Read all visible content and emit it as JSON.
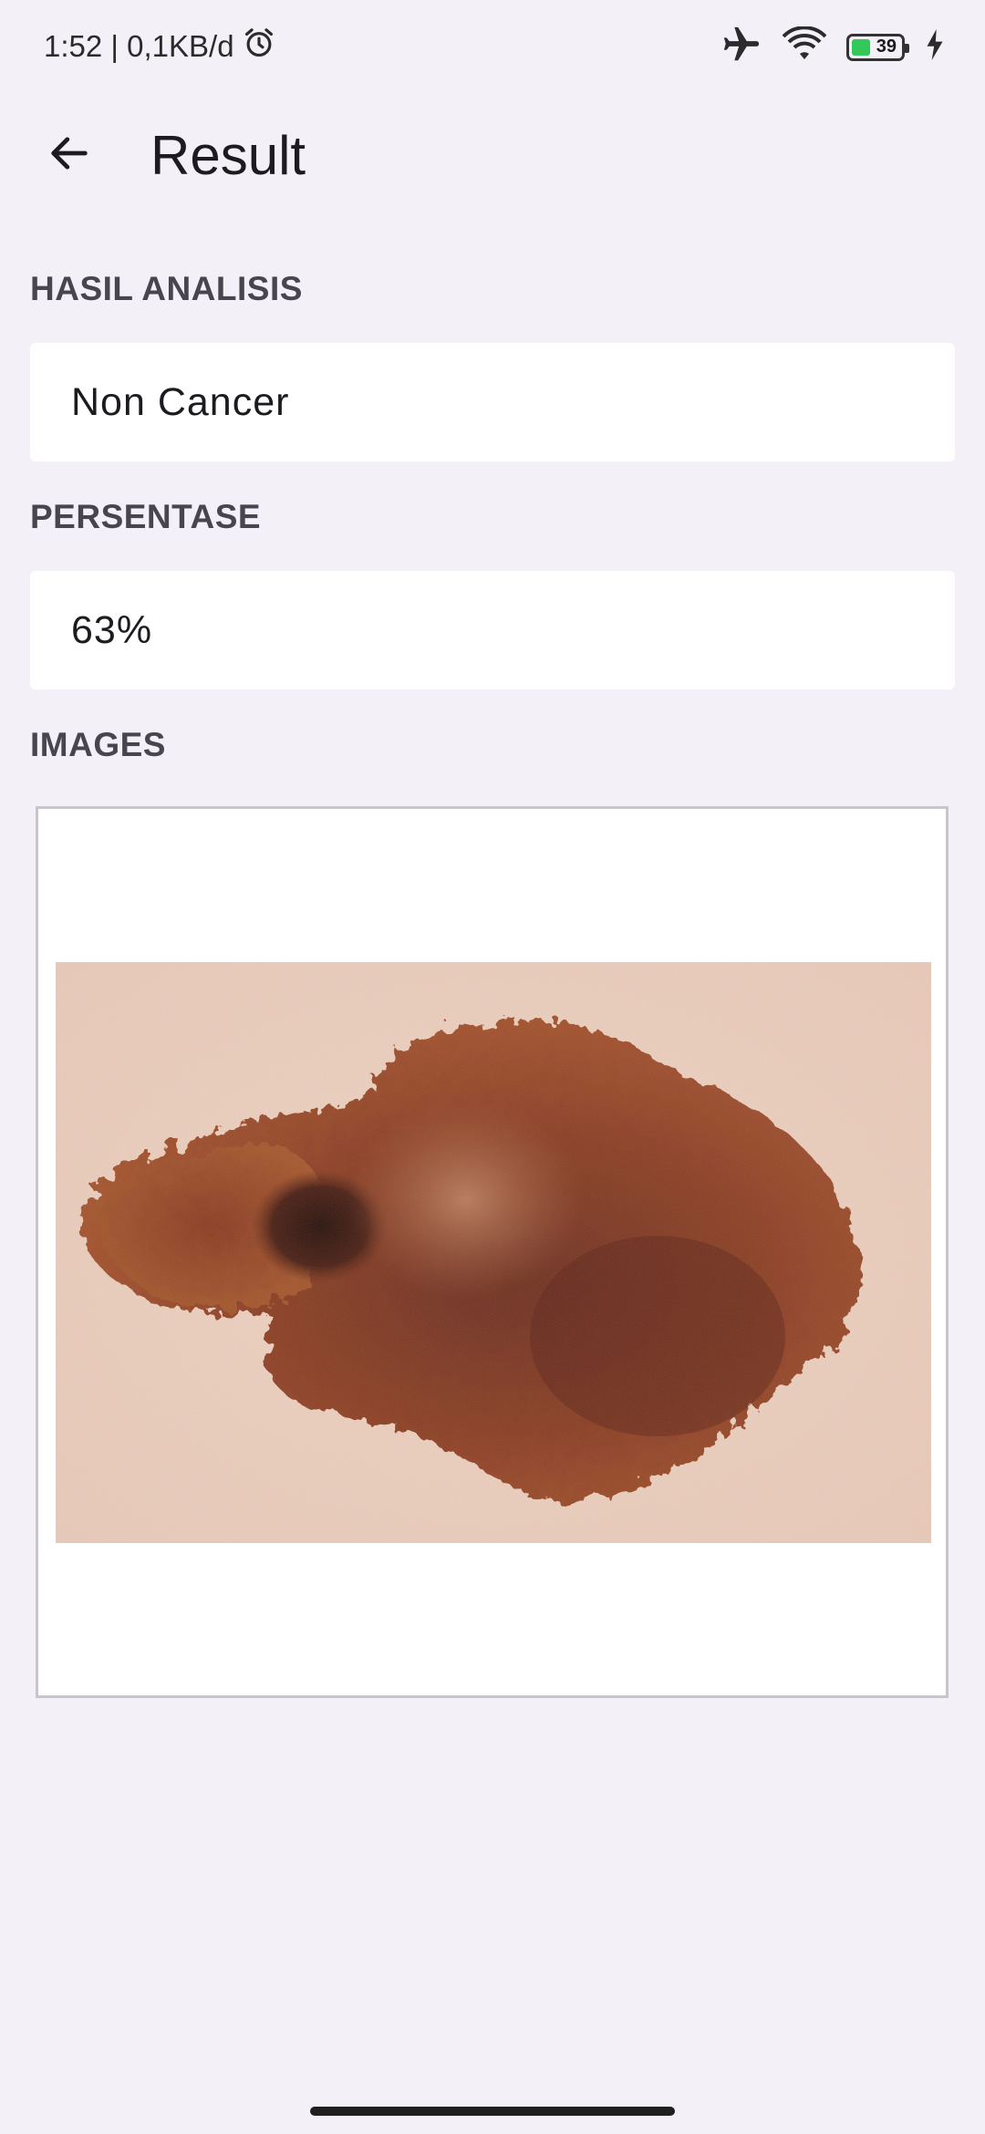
{
  "status_bar": {
    "time_and_speed": "1:52 | 0,1KB/d",
    "battery_level": "39",
    "battery_color": "#34c759",
    "icons": [
      "alarm-icon",
      "airplane-mode-icon",
      "wifi-icon",
      "battery-icon",
      "charging-bolt-icon"
    ]
  },
  "app_bar": {
    "title": "Result",
    "back_icon": "arrow-back-icon"
  },
  "sections": {
    "analysis_label": "HASIL ANALISIS",
    "analysis_value": "Non Cancer",
    "percentage_label": "PERSENTASE",
    "percentage_value": "63%",
    "images_label": "IMAGES"
  },
  "colors": {
    "background": "#f4f0f8",
    "field_background": "#ffffff",
    "label_color": "#49454f"
  }
}
